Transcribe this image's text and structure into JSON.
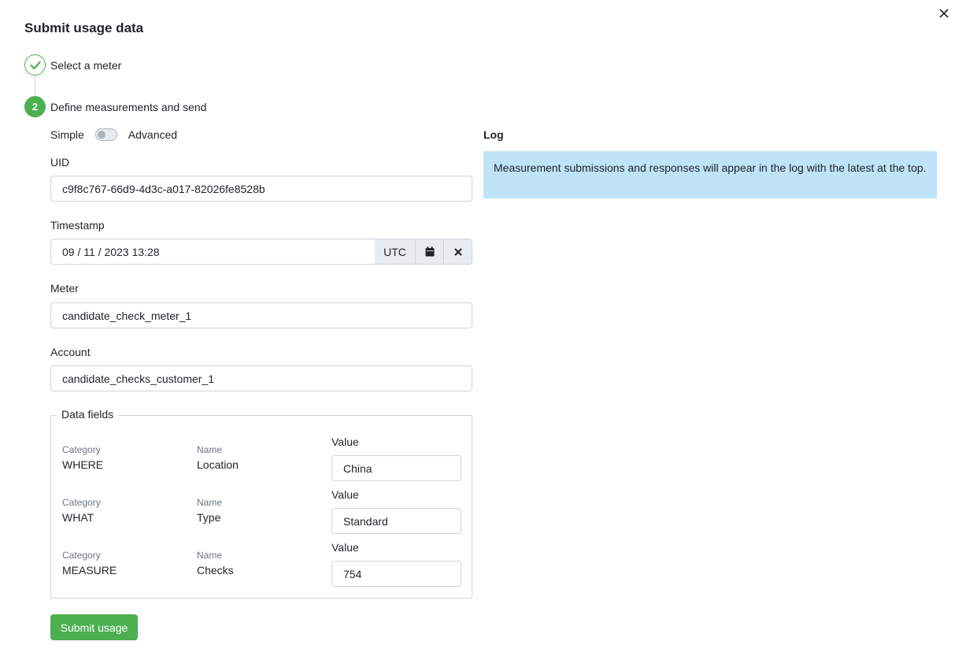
{
  "dialog": {
    "title": "Submit usage data",
    "close_icon": "close-icon"
  },
  "steps": [
    {
      "label": "Select a meter",
      "status": "done",
      "icon": "check-icon"
    },
    {
      "number": "2",
      "label": "Define measurements and send",
      "status": "active"
    }
  ],
  "mode": {
    "simple_label": "Simple",
    "advanced_label": "Advanced",
    "advanced_enabled": false
  },
  "form": {
    "uid": {
      "label": "UID",
      "value": "c9f8c767-66d9-4d3c-a017-82026fe8528b"
    },
    "timestamp": {
      "label": "Timestamp",
      "value": "09 / 11 / 2023 13:28",
      "timezone": "UTC",
      "calendar_icon": "calendar-icon",
      "clear_icon": "clear-icon"
    },
    "meter": {
      "label": "Meter",
      "value": "candidate_check_meter_1"
    },
    "account": {
      "label": "Account",
      "value": "candidate_checks_customer_1"
    }
  },
  "data_fields": {
    "legend": "Data fields",
    "rows": [
      {
        "category_label": "Category",
        "category": "WHERE",
        "name_label": "Name",
        "name": "Location",
        "value_label": "Value",
        "value": "China"
      },
      {
        "category_label": "Category",
        "category": "WHAT",
        "name_label": "Name",
        "name": "Type",
        "value_label": "Value",
        "value": "Standard"
      },
      {
        "category_label": "Category",
        "category": "MEASURE",
        "name_label": "Name",
        "name": "Checks",
        "value_label": "Value",
        "value": "754"
      }
    ]
  },
  "submit_label": "Submit usage",
  "log": {
    "title": "Log",
    "message": "Measurement submissions and responses will appear in the log with the latest at the top."
  },
  "colors": {
    "accent": "#4caf50",
    "info_bg": "#bfe3f7"
  }
}
